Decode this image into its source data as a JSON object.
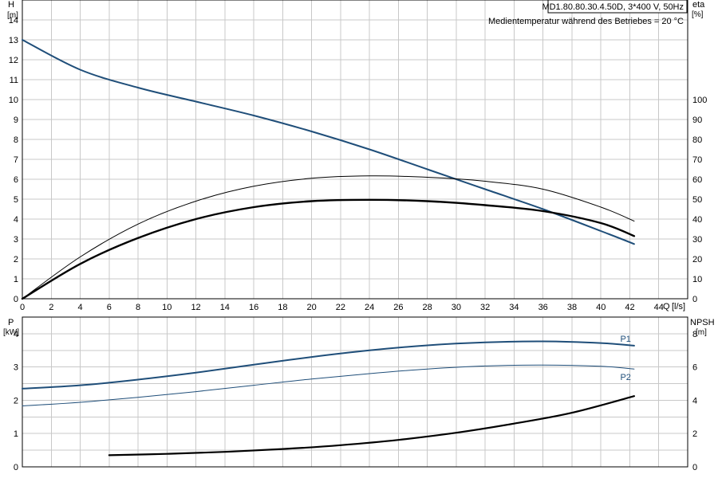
{
  "header": {
    "model": "MD1.80.80.30.4.50D, 3*400 V, 50Hz",
    "note": "Medientemperatur während des Betriebes = 20 °C"
  },
  "colors": {
    "blue": "#1f4e79",
    "black": "#000000",
    "grid": "#c8c8c8"
  },
  "chart_data": [
    {
      "type": "line",
      "panel": "top",
      "y_title": "H",
      "y_unit": "[m]",
      "y2_title": "eta",
      "y2_unit": "[%]",
      "x_title": "Q",
      "x_unit": "[l/s]",
      "xlim": [
        0,
        46
      ],
      "ylim": [
        0,
        15
      ],
      "y2lim": [
        0,
        150
      ],
      "x_ticks": [
        "0",
        "2",
        "4",
        "6",
        "8",
        "10",
        "12",
        "14",
        "16",
        "18",
        "20",
        "22",
        "24",
        "26",
        "28",
        "30",
        "32",
        "34",
        "36",
        "38",
        "40",
        "42",
        "44"
      ],
      "y_ticks": [
        "0",
        "1",
        "2",
        "3",
        "4",
        "5",
        "6",
        "7",
        "8",
        "9",
        "10",
        "11",
        "12",
        "13",
        "14"
      ],
      "y2_ticks": [
        "0",
        "10",
        "20",
        "30",
        "40",
        "50",
        "60",
        "70",
        "80",
        "90",
        "100"
      ],
      "series": [
        {
          "key": "H",
          "axis": "left",
          "color": "#1f4e79",
          "width": 2,
          "x": [
            0,
            4,
            8,
            12,
            16,
            20,
            24,
            28,
            32,
            36,
            40,
            42.3
          ],
          "y": [
            13,
            11.5,
            10.6,
            9.9,
            9.2,
            8.4,
            7.5,
            6.5,
            5.5,
            4.5,
            3.4,
            2.75
          ]
        },
        {
          "key": "eta",
          "axis": "right",
          "color": "#000000",
          "width": 1,
          "x": [
            0,
            4,
            8,
            12,
            16,
            20,
            24,
            28,
            32,
            36,
            40,
            42.3
          ],
          "y": [
            0,
            21,
            37.5,
            49,
            56.5,
            60.5,
            61.7,
            61,
            59,
            55,
            46,
            39
          ]
        },
        {
          "key": "eta_total",
          "axis": "right",
          "color": "#000000",
          "width": 2.4,
          "x": [
            0,
            4,
            8,
            12,
            16,
            20,
            24,
            28,
            32,
            36,
            40,
            42.3
          ],
          "y": [
            0,
            17.5,
            30.5,
            40,
            46,
            49,
            49.7,
            49,
            47,
            44,
            38,
            31.5
          ]
        }
      ]
    },
    {
      "type": "line",
      "panel": "bottom",
      "y_title": "P",
      "y_unit": "[kW]",
      "y2_title": "NPSH",
      "y2_unit": "[m]",
      "xlim": [
        0,
        46
      ],
      "ylim": [
        0,
        4.5
      ],
      "y2lim": [
        0,
        9
      ],
      "y_ticks": [
        "0",
        "1",
        "2",
        "3",
        "4"
      ],
      "y2_ticks": [
        "0",
        "2",
        "4",
        "6",
        "8"
      ],
      "series": [
        {
          "name": "P1",
          "axis": "left",
          "color": "#1f4e79",
          "width": 2,
          "x": [
            0,
            4,
            8,
            12,
            16,
            20,
            24,
            28,
            32,
            36,
            40,
            42.3
          ],
          "y": [
            2.35,
            2.45,
            2.62,
            2.83,
            3.07,
            3.3,
            3.5,
            3.65,
            3.74,
            3.77,
            3.72,
            3.64
          ]
        },
        {
          "name": "P2",
          "axis": "left",
          "color": "#1f4e79",
          "width": 1,
          "x": [
            0,
            4,
            8,
            12,
            16,
            20,
            24,
            28,
            32,
            36,
            40,
            42.3
          ],
          "y": [
            1.83,
            1.94,
            2.09,
            2.26,
            2.45,
            2.64,
            2.8,
            2.94,
            3.03,
            3.06,
            3.02,
            2.94
          ]
        },
        {
          "key": "NPSH",
          "axis": "right",
          "color": "#000000",
          "width": 2.2,
          "x": [
            6,
            10,
            14,
            18,
            22,
            26,
            30,
            34,
            38,
            42.3
          ],
          "y": [
            0.7,
            0.78,
            0.9,
            1.07,
            1.3,
            1.62,
            2.05,
            2.6,
            3.25,
            4.25
          ]
        }
      ]
    }
  ]
}
